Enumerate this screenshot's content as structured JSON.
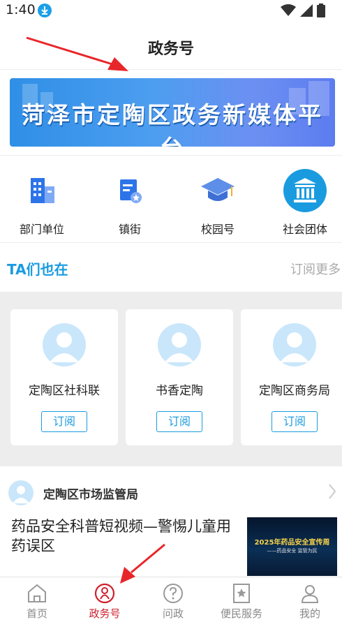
{
  "status": {
    "time": "1:40"
  },
  "header": {
    "title": "政务号"
  },
  "banner": {
    "text": "菏泽市定陶区政务新媒体平台"
  },
  "categories": [
    {
      "label": "部门单位",
      "icon": "building-icon"
    },
    {
      "label": "镇街",
      "icon": "document-badge-icon"
    },
    {
      "label": "校园号",
      "icon": "graduation-cap-icon"
    },
    {
      "label": "社会团体",
      "icon": "institution-icon"
    }
  ],
  "ta_section": {
    "title": "TA们也在",
    "more": "订阅更多"
  },
  "cards": [
    {
      "name": "定陶区社科联",
      "button": "订阅"
    },
    {
      "name": "书香定陶",
      "button": "订阅"
    },
    {
      "name": "定陶区商务局",
      "button": "订阅"
    }
  ],
  "news": {
    "source": "定陶区市场监管局",
    "title": "药品安全科普短视频—警惕儿童用药误区",
    "thumb_line1": "2025年药品安全宣传周",
    "thumb_line2": "——药品安全   监管为民"
  },
  "nav": [
    {
      "label": "首页",
      "icon": "home-icon",
      "active": false
    },
    {
      "label": "政务号",
      "icon": "gov-account-icon",
      "active": true
    },
    {
      "label": "问政",
      "icon": "question-icon",
      "active": false
    },
    {
      "label": "便民服务",
      "icon": "bookmark-star-icon",
      "active": false
    },
    {
      "label": "我的",
      "icon": "user-icon",
      "active": false
    }
  ],
  "colors": {
    "accent": "#1a9be0",
    "nav_active": "#d0202e",
    "annotation_arrow": "#e8262a"
  }
}
